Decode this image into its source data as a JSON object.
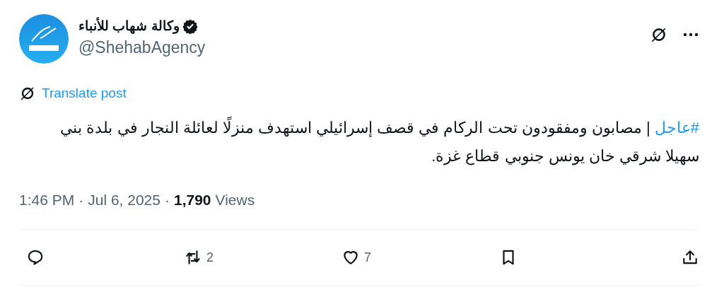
{
  "author": {
    "name": "وكالة شهاب للأنباء",
    "verified": true,
    "handle": "@ShehabAgency"
  },
  "translate": {
    "label": "Translate post"
  },
  "post": {
    "hashtag": "#عاجل",
    "text": " | مصابون ومفقودون تحت الركام في قصف إسرائيلي استهدف منزلًا لعائلة النجار في بلدة بني سهيلا شرقي خان يونس جنوبي قطاع غزة."
  },
  "meta": {
    "time": "1:46 PM",
    "separator_1": "·",
    "date": "Jul 6, 2025",
    "separator_2": "·",
    "views_count": "1,790",
    "views_label": "Views"
  },
  "actions": {
    "repost_count": "2",
    "like_count": "7"
  }
}
